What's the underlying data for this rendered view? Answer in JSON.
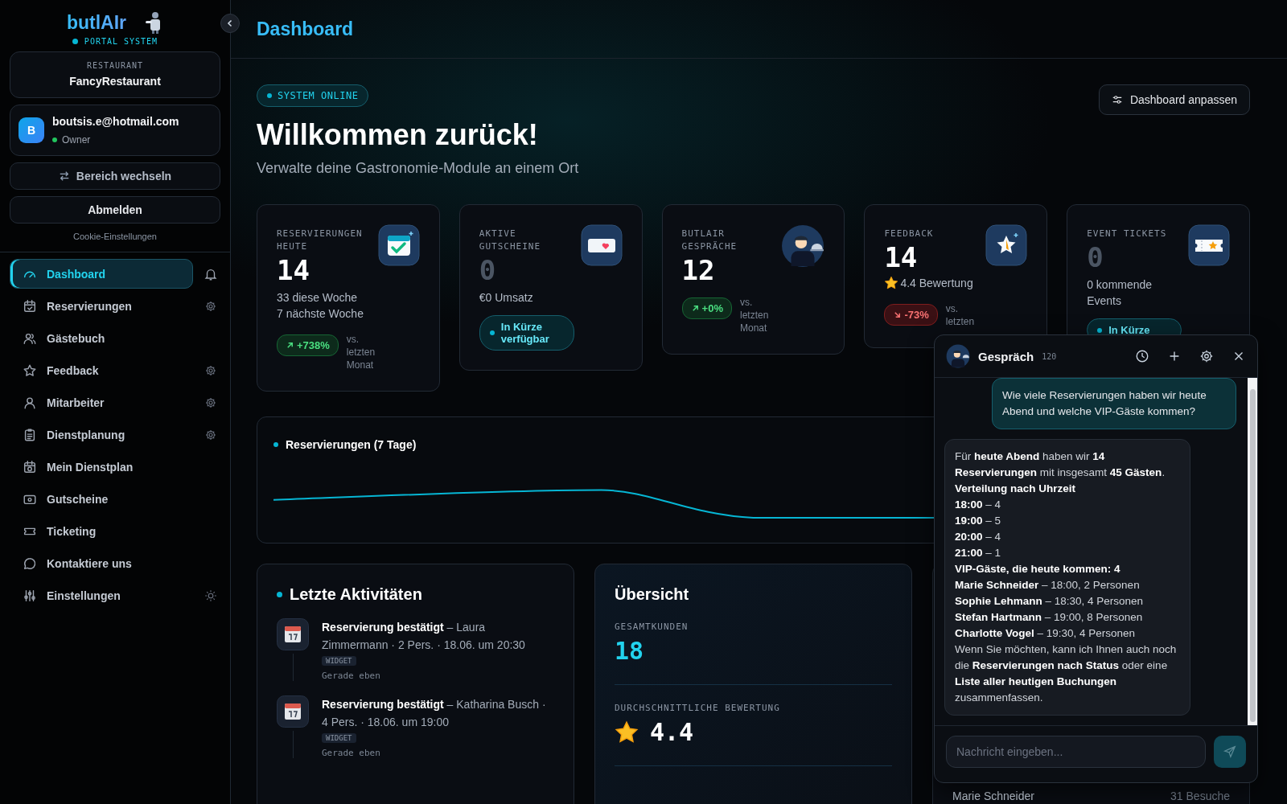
{
  "sidebar": {
    "logo": "butlAIr",
    "subtitle": "PORTAL SYSTEM",
    "restaurant_label": "RESTAURANT",
    "restaurant": "FancyRestaurant",
    "user": {
      "initial": "B",
      "email": "boutsis.e@hotmail.com",
      "role": "Owner",
      "online": true
    },
    "switch_button": "Bereich wechseln",
    "logout_button": "Abmelden",
    "cookie_link": "Cookie-Einstellungen",
    "nav": [
      {
        "label": "Dashboard",
        "kind": "gauge",
        "selected": true,
        "settings": false
      },
      {
        "label": "Reservierungen",
        "kind": "calendar",
        "selected": false,
        "settings": true
      },
      {
        "label": "Gästebuch",
        "kind": "users",
        "selected": false,
        "settings": false
      },
      {
        "label": "Feedback",
        "kind": "star",
        "selected": false,
        "settings": true
      },
      {
        "label": "Mitarbeiter",
        "kind": "user",
        "selected": false,
        "settings": true
      },
      {
        "label": "Dienstplanung",
        "kind": "clipboard",
        "selected": false,
        "settings": true
      },
      {
        "label": "Mein Dienstplan",
        "kind": "planner",
        "selected": false,
        "settings": false
      },
      {
        "label": "Gutscheine",
        "kind": "wallet",
        "selected": false,
        "settings": false
      },
      {
        "label": "Ticketing",
        "kind": "ticket",
        "selected": false,
        "settings": false
      },
      {
        "label": "Kontaktiere uns",
        "kind": "chat",
        "selected": false,
        "settings": false
      },
      {
        "label": "Einstellungen",
        "kind": "sliders",
        "selected": false,
        "settings": false
      }
    ]
  },
  "header": {
    "title": "Dashboard"
  },
  "hero": {
    "status": "SYSTEM ONLINE",
    "customize_button": "Dashboard anpassen",
    "title": "Willkommen zurück!",
    "subtitle": "Verwalte deine Gastronomie-Module an einem Ort"
  },
  "stats": [
    {
      "label": "RESERVIERUNGEN HEUTE",
      "value": "14",
      "muted": false,
      "kind": "calendar",
      "lines": [
        "33 diese Woche",
        "7 nächste Woche"
      ],
      "trend": {
        "text": "+738%",
        "rising": true
      },
      "note": "vs. letzten Monat"
    },
    {
      "label": "AKTIVE GUTSCHEINE",
      "value": "0",
      "muted": true,
      "kind": "voucher",
      "lines": [
        "€0 Umsatz"
      ],
      "badge": "In Kürze verfügbar"
    },
    {
      "label": "BUTLAIR GESPRÄCHE",
      "value": "12",
      "muted": false,
      "kind": "butler",
      "trend": {
        "text": "+0%",
        "rising": true
      },
      "note": "vs. letzten Monat"
    },
    {
      "label": "FEEDBACK",
      "value": "14",
      "muted": false,
      "kind": "star",
      "rating": "4.4 Bewertung",
      "trend": {
        "text": "-73%",
        "rising": false
      },
      "note": "vs. letzten"
    },
    {
      "label": "EVENT TICKETS",
      "value": "0",
      "muted": true,
      "kind": "ticket",
      "lines": [
        "0 kommende Events"
      ],
      "badge": "In Kürze"
    }
  ],
  "chart": {
    "title": "Reservierungen (7 Tage)"
  },
  "activities": {
    "title": "Letzte Aktivitäten",
    "items": [
      {
        "text": "**Reservierung bestätigt** – Laura Zimmermann · 2 Pers. · 18.06. um 20:30",
        "tag": "WIDGET",
        "time": "Gerade eben"
      },
      {
        "text": "**Reservierung bestätigt** – Katharina Busch · 4 Pers. · 18.06. um 19:00",
        "tag": "WIDGET",
        "time": "Gerade eben"
      }
    ]
  },
  "overview": {
    "title": "Übersicht",
    "metrics": [
      {
        "label": "GESAMTKUNDEN",
        "value": "18",
        "kind": "count"
      },
      {
        "label": "DURCHSCHNITTLICHE BEWERTUNG",
        "value": "4.4",
        "kind": "rating"
      }
    ]
  },
  "guests": {
    "rows": [
      {
        "name": "Marie Schneider",
        "visits": "31 Besuche"
      }
    ]
  },
  "chat": {
    "title": "Gespräch",
    "count": "120",
    "messages": [
      {
        "from_user": true,
        "lines": [
          "Wie viele Reservierungen haben wir heute Abend und welche VIP-Gäste kommen?"
        ]
      },
      {
        "from_user": false,
        "lines": [
          "Für **heute Abend** haben wir **14 Reservierungen** mit insgesamt **45 Gästen**.",
          "**Verteilung nach Uhrzeit**",
          "**18:00** – 4",
          "**19:00** – 5",
          "**20:00** – 4",
          "**21:00** – 1",
          "**VIP-Gäste, die heute kommen: 4**",
          "**Marie Schneider** – 18:00, 2 Personen",
          "**Sophie Lehmann** – 18:30, 4 Personen",
          "**Stefan Hartmann** – 19:00, 8 Personen",
          "**Charlotte Vogel** – 19:30, 4 Personen",
          "Wenn Sie möchten, kann ich Ihnen auch noch die **Reservierungen nach Status** oder eine **Liste aller heutigen Buchungen** zusammenfassen."
        ]
      }
    ],
    "placeholder": "Nachricht eingeben..."
  }
}
